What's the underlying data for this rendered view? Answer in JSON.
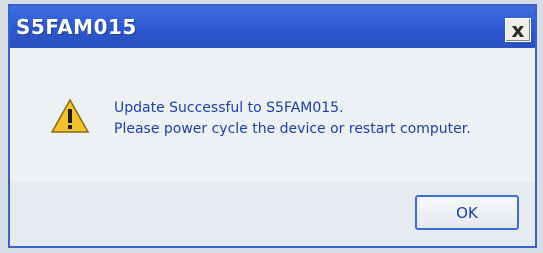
{
  "window": {
    "title": "S5FAM015",
    "close_label": "x"
  },
  "message": {
    "icon": "warning-triangle-icon",
    "line1": "Update Successful to S5FAM015.",
    "line2": "Please power cycle the device or restart computer."
  },
  "buttons": {
    "ok_label": "OK"
  },
  "colors": {
    "titlebar": "#2c58cf",
    "text": "#1a3fb0",
    "warning": "#f2c230"
  }
}
